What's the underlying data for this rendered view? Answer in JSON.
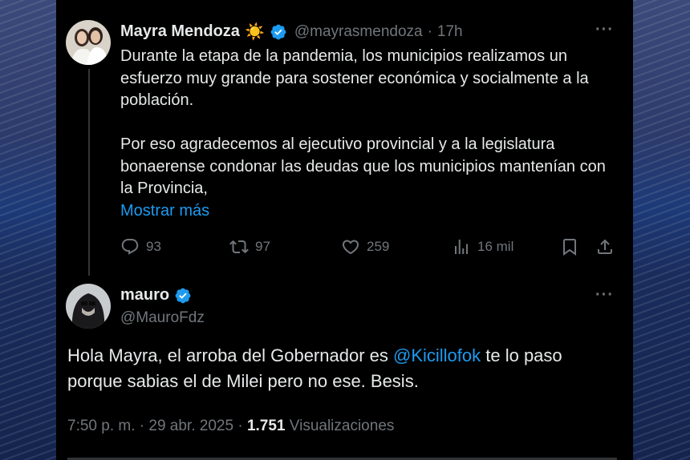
{
  "parent_tweet": {
    "author_name": "Mayra Mendoza",
    "author_emoji": "☀️",
    "author_handle": "@mayrasmendoza",
    "separator": "·",
    "time_ago": "17h",
    "text_paragraph_1": "Durante la etapa de la pandemia, los municipios realizamos un esfuerzo muy grande para sostener económica y socialmente a la población.",
    "text_paragraph_2": "Por eso agradecemos al ejecutivo provincial y a la legislatura bonaerense condonar las deudas que los municipios mantenían con la Provincia,",
    "show_more": "Mostrar más",
    "replies": "93",
    "retweets": "97",
    "likes": "259",
    "views": "16 mil"
  },
  "reply_tweet": {
    "author_name": "mauro",
    "author_handle": "@MauroFdz",
    "text_before": "Hola Mayra, el arroba del Gobernador es ",
    "mention": "@Kicillofok",
    "text_after": " te lo paso porque sabias el de Milei pero no ese. Besis.",
    "time": "7:50 p. m.",
    "separator_1": "·",
    "date": "29 abr. 2025",
    "separator_2": "·",
    "views_count": "1.751",
    "views_label": "Visualizaciones"
  },
  "colors": {
    "background": "#000000",
    "text": "#e7e9ea",
    "muted": "#71767b",
    "link": "#1d9bf0",
    "verified": "#1d9bf0"
  }
}
